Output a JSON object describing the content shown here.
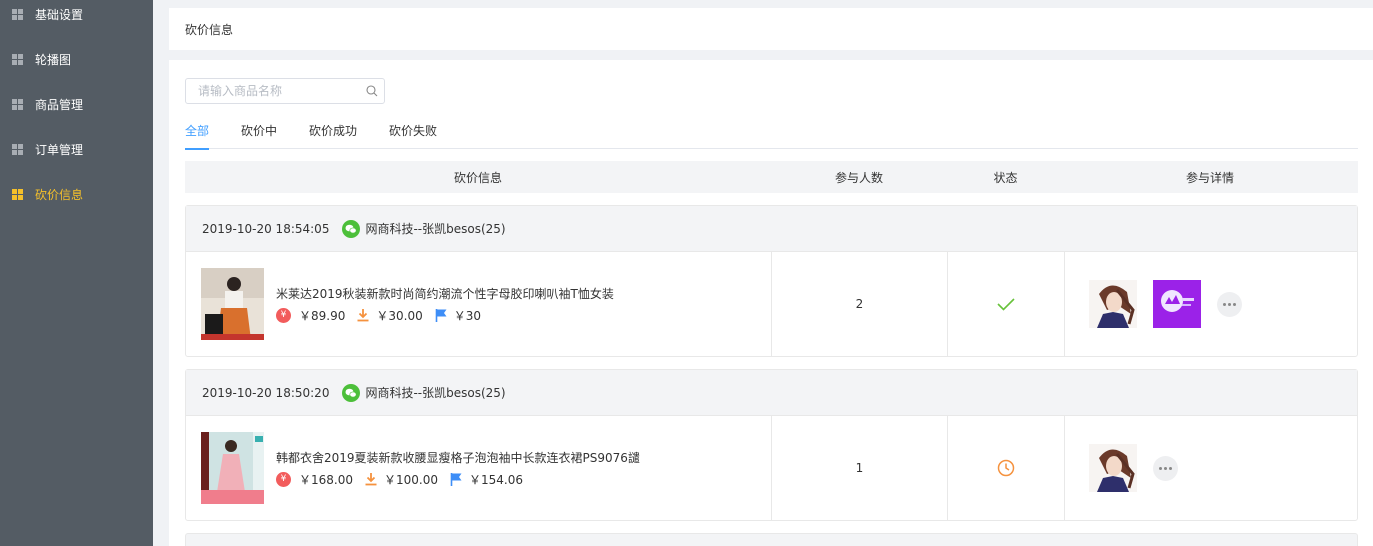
{
  "sidebar": {
    "items": [
      {
        "label": "基础设置",
        "icon": "grid-icon",
        "active": false
      },
      {
        "label": "轮播图",
        "icon": "grid-icon",
        "active": false
      },
      {
        "label": "商品管理",
        "icon": "grid-icon",
        "active": false
      },
      {
        "label": "订单管理",
        "icon": "grid-icon",
        "active": false
      },
      {
        "label": "砍价信息",
        "icon": "grid-icon",
        "active": true
      }
    ]
  },
  "header": {
    "title": "砍价信息"
  },
  "search": {
    "placeholder": "请输入商品名称",
    "value": ""
  },
  "tabs": [
    {
      "label": "全部",
      "active": true
    },
    {
      "label": "砍价中",
      "active": false
    },
    {
      "label": "砍价成功",
      "active": false
    },
    {
      "label": "砍价失败",
      "active": false
    }
  ],
  "table": {
    "columns": [
      "砍价信息",
      "参与人数",
      "状态",
      "参与详情"
    ]
  },
  "orders": [
    {
      "time": "2019-10-20 18:54:05",
      "user": "网商科技--张凯besos(25)",
      "product": "米莱达2019秋装新款时尚简约潮流个性字母胶印喇叭袖T恤女装",
      "price_original": "￥89.90",
      "price_bargain": "￥30.00",
      "price_final": "￥30",
      "participants": "2",
      "status": "success",
      "status_icon": "check-icon"
    },
    {
      "time": "2019-10-20 18:50:20",
      "user": "网商科技--张凯besos(25)",
      "product": "韩都衣舍2019夏装新款收腰显瘦格子泡泡袖中长款连衣裙PS9076譴",
      "price_original": "￥168.00",
      "price_bargain": "￥100.00",
      "price_final": "￥154.06",
      "participants": "1",
      "status": "pending",
      "status_icon": "clock-icon"
    }
  ],
  "colors": {
    "sidebar_bg": "#545c64",
    "active_nav": "#f5c02a",
    "tab_active": "#409eff",
    "success": "#67c23a",
    "pending": "#f5923e",
    "wechat": "#4cbf3a"
  }
}
